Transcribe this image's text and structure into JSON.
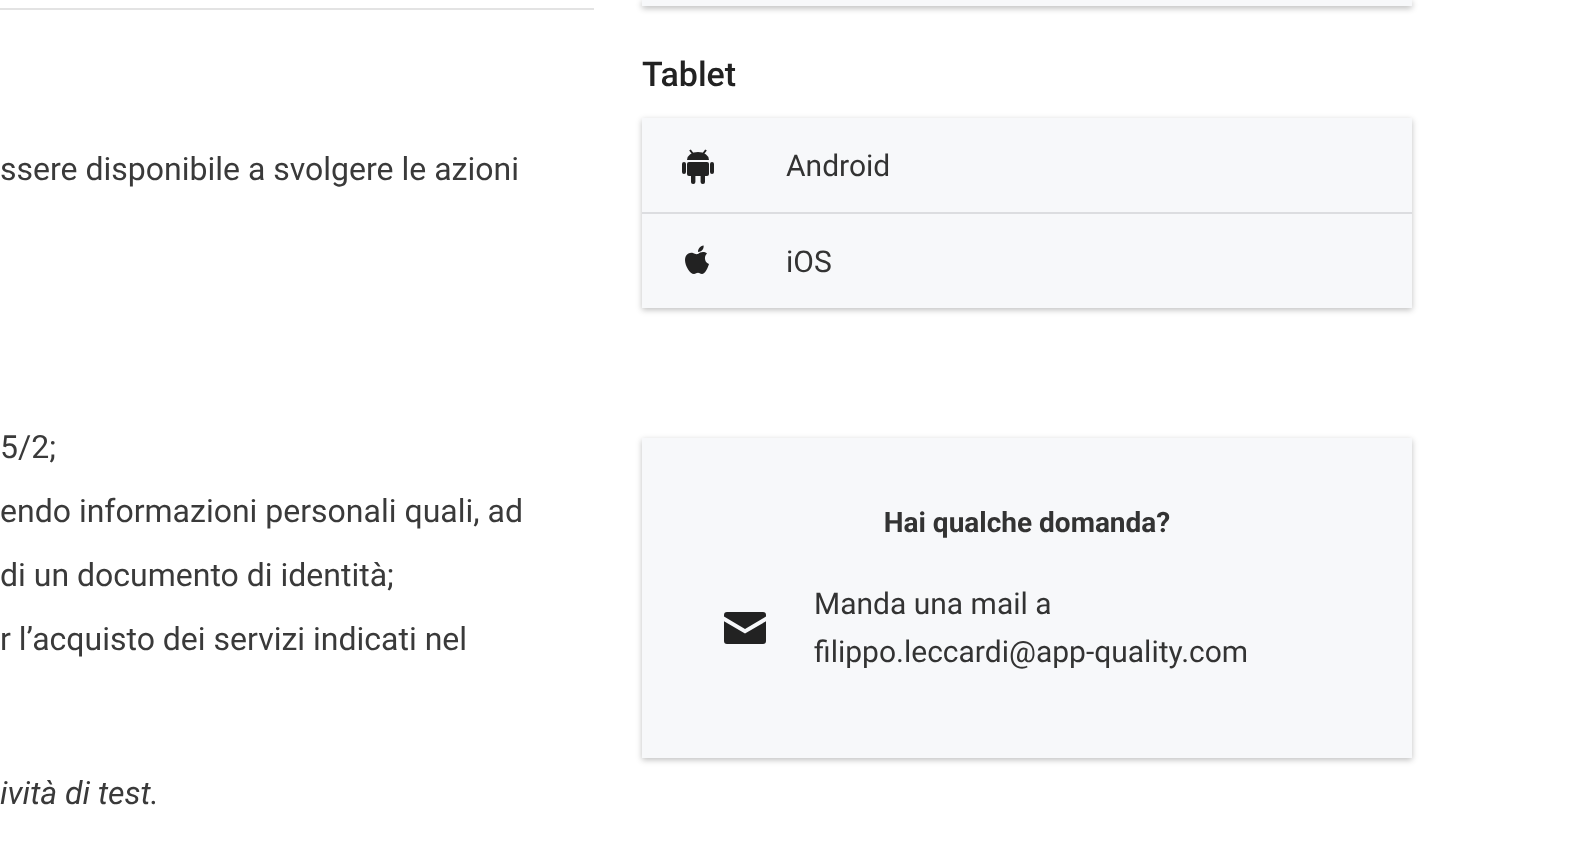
{
  "content": {
    "paragraphs": [
      {
        "lines": [
          {
            "text": "ssere disponibile a svolgere le azioni",
            "italic": false
          }
        ]
      },
      {
        "lines": [
          {
            "text": "5/2;",
            "italic": false
          },
          {
            "text": "endo informazioni personali quali, ad",
            "italic": false
          },
          {
            "text": "di un documento di identità;",
            "italic": false
          },
          {
            "text": "r l’acquisto dei servizi indicati nel",
            "italic": false
          }
        ]
      },
      {
        "lines": [
          {
            "text": "ività di test.",
            "italic": true
          }
        ]
      }
    ]
  },
  "devices": {
    "heading": "Tablet",
    "items": [
      {
        "kind": "android",
        "label": "Android"
      },
      {
        "kind": "apple",
        "label": "iOS"
      }
    ]
  },
  "contact": {
    "title": "Hai qualche domanda?",
    "lines": [
      "Manda una mail a",
      "filippo.leccardi@app-quality.com"
    ]
  }
}
